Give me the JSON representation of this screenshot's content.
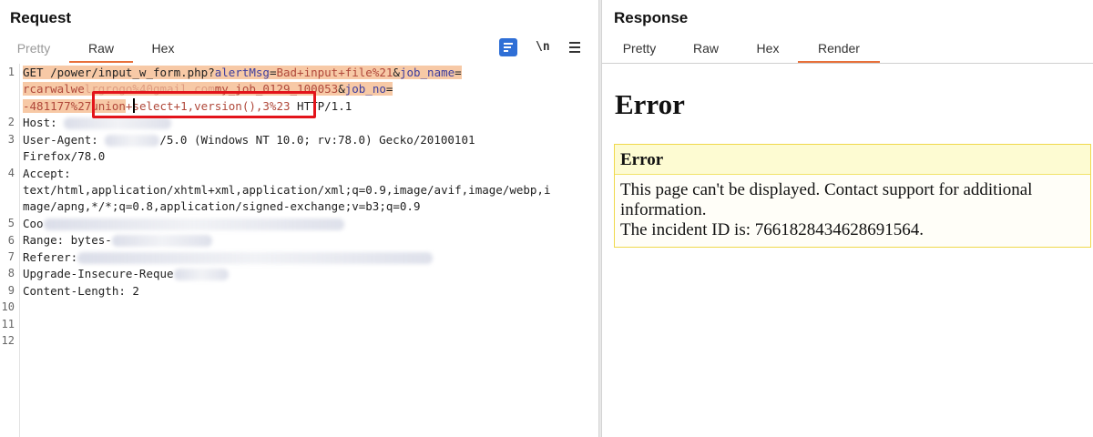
{
  "request": {
    "title": "Request",
    "tabs": [
      "Pretty",
      "Raw",
      "Hex"
    ],
    "active_tab": "Raw",
    "toolbar": {
      "newline_label": "\\n"
    },
    "line_numbers": [
      "1",
      "2",
      "3",
      "4",
      "5",
      "6",
      "7",
      "8",
      "9",
      "10",
      "11",
      "12"
    ],
    "lines": {
      "l1_method": "GET /power/input_w_form.php?",
      "l1_k1": "alertMsg",
      "l1_eq1": "=",
      "l1_v1": "Bad+input+file%21",
      "l1_amp1": "&",
      "l1_k2": "job_name",
      "l1_eq2": "=",
      "l1b_v2": "rcarwalwe",
      "l1b_blur": "lrgrogo%40gmail.com",
      "l1b_v2b": "my_job_0129_100053",
      "l1b_amp": "&",
      "l1b_k3": "job_no",
      "l1b_eq": "=",
      "l1c_v3": "-481177%27union",
      "l1c_inj": "+select+1,version(),3%23",
      "l1c_proto": " HTTP/1.1",
      "l2": "Host: ",
      "l3a": "User-Agent: ",
      "l3b": "/5.0 (Windows NT 10.0; rv:78.0) Gecko/20100101",
      "l3c": "Firefox/78.0",
      "l4": "Accept:",
      "l4b": "text/html,application/xhtml+xml,application/xml;q=0.9,image/avif,image/webp,i",
      "l4c": "mage/apng,*/*;q=0.8,application/signed-exchange;v=b3;q=0.9",
      "l5": "Coo",
      "l6": "Range: bytes-",
      "l7": "Referer:",
      "l8": "Upgrade-Insecure-Reque",
      "l9": "Content-Length: 2"
    }
  },
  "response": {
    "title": "Response",
    "tabs": [
      "Pretty",
      "Raw",
      "Hex",
      "Render"
    ],
    "active_tab": "Render",
    "render": {
      "heading": "Error",
      "box_title": "Error",
      "box_line1": "This page can't be displayed. Contact support for additional",
      "box_line2": "information.",
      "box_line3": "The incident ID is: 7661828434628691564."
    }
  },
  "colors": {
    "accent_tab_underline": "#e8703a",
    "request_highlight": "#f7c9a6",
    "annotation_box": "#e3141b",
    "error_box_border": "#f0d94c"
  },
  "icons": [
    "wrap-lines-icon",
    "newline-icon",
    "menu-icon"
  ]
}
